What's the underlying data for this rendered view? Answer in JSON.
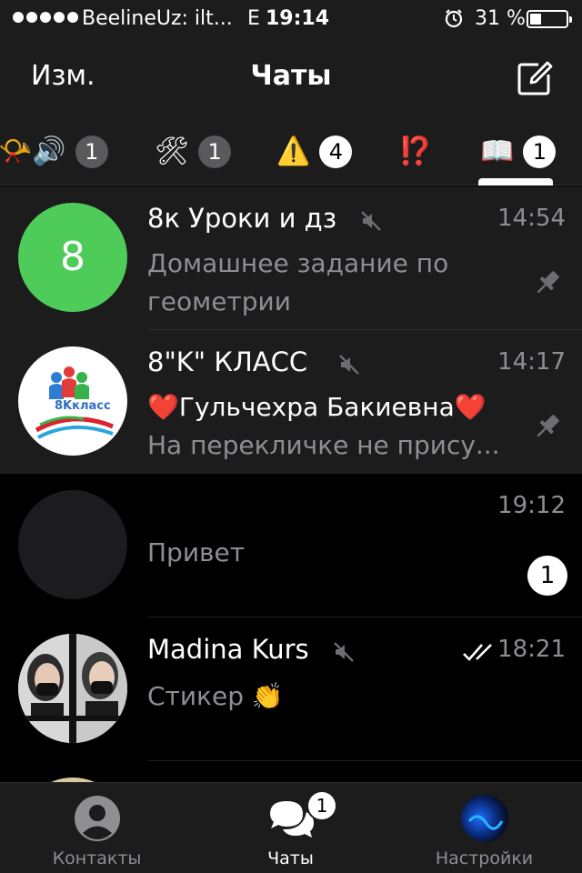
{
  "status_bar": {
    "carrier": "BeelineUz: ilt...",
    "network": "E",
    "time": "19:14",
    "battery_percent": "31 %",
    "battery_level": 0.31,
    "icons": [
      "signal-dots-icon",
      "alarm-icon",
      "battery-icon"
    ]
  },
  "nav": {
    "edit_label": "Изм.",
    "title": "Чаты",
    "compose_icon": "compose-icon"
  },
  "folders": [
    {
      "emoji": "📯🔊",
      "badge": "1",
      "active": false
    },
    {
      "emoji": "🛠",
      "badge": "1",
      "active": false
    },
    {
      "emoji": "⚠️",
      "badge": "4",
      "active": false
    },
    {
      "emoji": "⁉️",
      "badge": "",
      "active": false
    },
    {
      "emoji": "📖",
      "badge": "1",
      "active": true
    }
  ],
  "chats": [
    {
      "name": "8к Уроки и дз",
      "avatar_letter": "8",
      "muted": true,
      "time": "14:54",
      "preview": "Домашнее задание по геометрии",
      "pinned": true
    },
    {
      "name": "8\"K\" КЛАСС",
      "avatar_logo_text": "8Kкласс",
      "muted": true,
      "time": "14:17",
      "sender": "❤️Гульчехра Бакиевна❤️",
      "preview": "На перекличке не прису...",
      "pinned": true
    },
    {
      "name": "",
      "time": "19:12",
      "preview": "Привет",
      "unread": "1"
    },
    {
      "name": "Madina Kurs",
      "muted": true,
      "time": "18:21",
      "read": true,
      "preview": "Стикер 👏"
    }
  ],
  "tab_bar": {
    "contacts_label": "Контакты",
    "chats_label": "Чаты",
    "chats_badge": "1",
    "settings_label": "Настройки"
  },
  "colors": {
    "background": "#000000",
    "bar_background": "#1c1c1d",
    "secondary_text": "#8e8e93",
    "avatar_green": "#4fcb5a"
  }
}
